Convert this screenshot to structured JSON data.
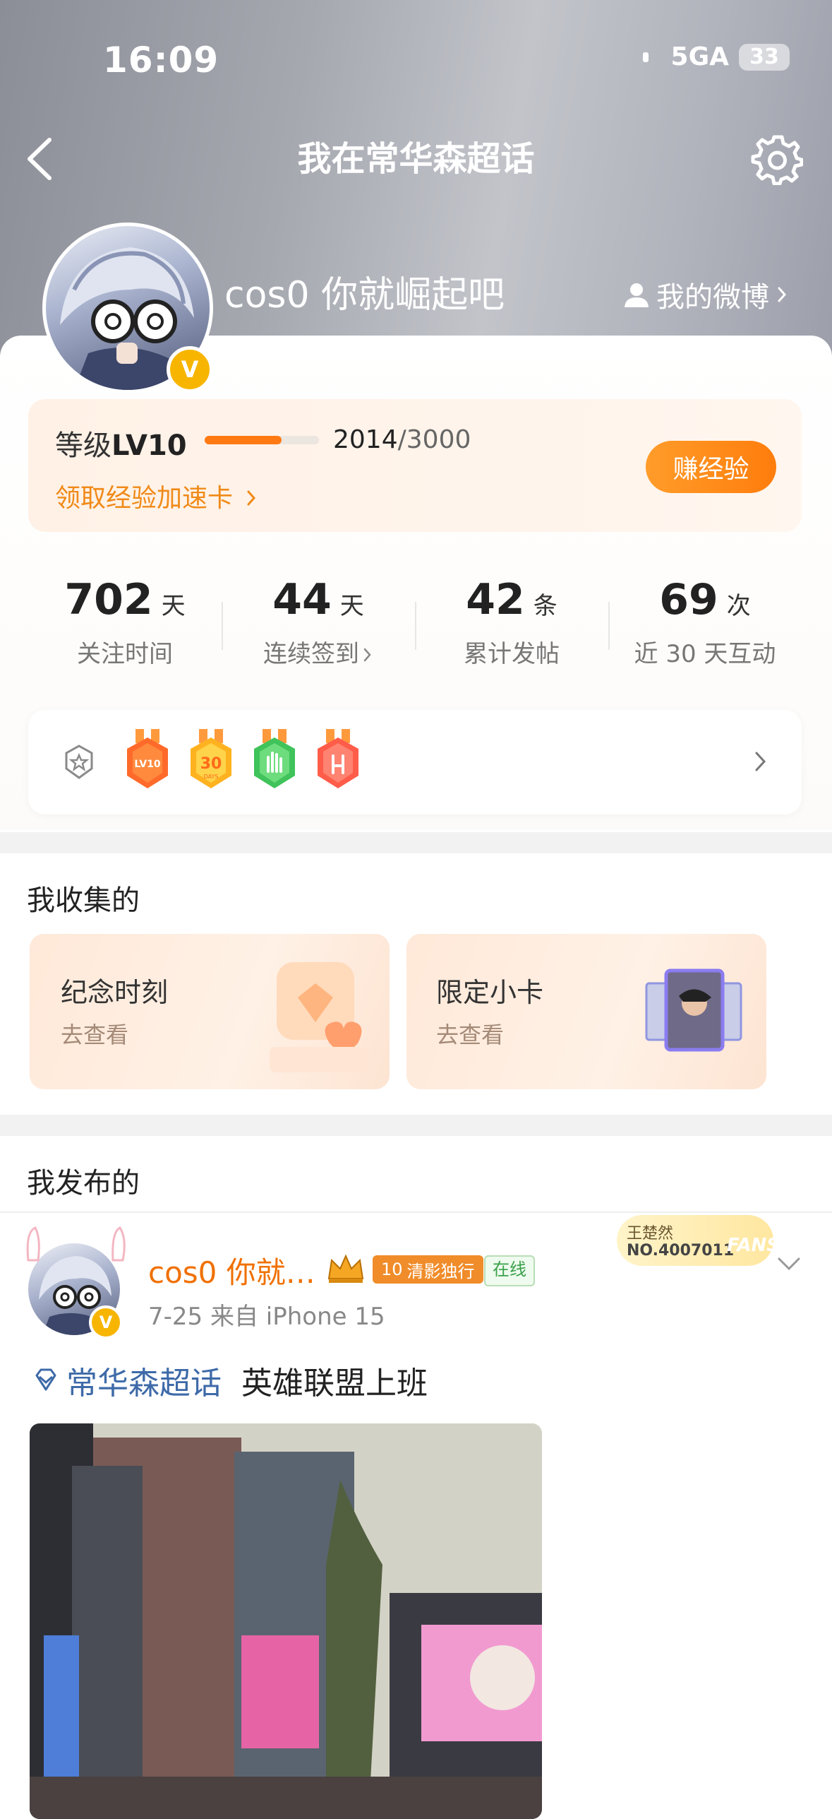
{
  "status_bar": {
    "time": "16:09",
    "network": "5GA",
    "battery": "33"
  },
  "nav": {
    "title": "我在常华森超话"
  },
  "profile": {
    "username": "cos0 你就崛起吧",
    "my_weibo": "我的微博",
    "verified_mark": "V"
  },
  "level": {
    "label_prefix": "等级",
    "level": "LV10",
    "exp_current": "2014",
    "exp_max": "/3000",
    "progress": 0.671,
    "speedup_link": "领取经验加速卡",
    "earn_button": "赚经验"
  },
  "stats": [
    {
      "value": "702",
      "unit": "天",
      "label": "关注时间"
    },
    {
      "value": "44",
      "unit": "天",
      "label": "连续签到"
    },
    {
      "value": "42",
      "unit": "条",
      "label": "累计发帖"
    },
    {
      "value": "69",
      "unit": "次",
      "label": "近 30 天互动"
    }
  ],
  "badges": {
    "items": [
      "LV10",
      "30"
    ],
    "item2_sub": "DAYS"
  },
  "collection": {
    "title": "我收集的",
    "cards": [
      {
        "title": "纪念时刻",
        "sub": "去查看"
      },
      {
        "title": "限定小卡",
        "sub": "去查看"
      }
    ]
  },
  "posts": {
    "title": "我发布的",
    "item": {
      "username": "cos0 你就…",
      "tag_num": "10",
      "tag_text": "清影独行",
      "online": "在线",
      "fans_name": "王楚然",
      "fans_no": "NO.4007011",
      "fans_word": "FANS",
      "meta": "7-25  来自 iPhone 15",
      "topic": "常华森超话",
      "text": "英雄联盟上班"
    }
  },
  "colors": {
    "accent": "#ff7a12",
    "link": "#f08a18",
    "topic": "#3e6aa8",
    "verified": "#f7b500"
  }
}
